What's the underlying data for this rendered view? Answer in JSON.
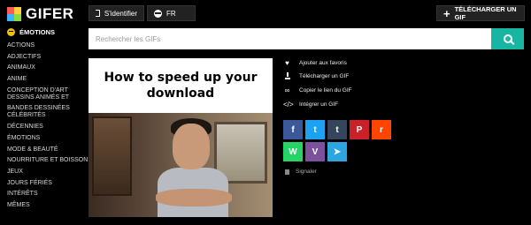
{
  "brand": {
    "name": "GIFER"
  },
  "header": {
    "signin_label": "S'identifier",
    "language_label": "FR",
    "upload_label": "TÉLÉCHARGER UN GIF"
  },
  "search": {
    "placeholder": "Rechercher les GIFs",
    "value": ""
  },
  "sidebar": {
    "title": "ÉMOTIONS",
    "items": [
      "ACTIONS",
      "ADJECTIFS",
      "ANIMAUX",
      "ANIME",
      "CONCEPTION D'ART DESSINS ANIMÉS ET",
      "BANDES DESSINÉES CÉLÉBRITÉS",
      "DÉCENNIES",
      "ÉMOTIONS",
      "MODE & BEAUTÉ",
      "NOURRITURE ET BOISSON",
      "JEUX",
      "JOURS FÉRIÉS",
      "INTÉRÊTS",
      "MÊMES"
    ]
  },
  "media": {
    "caption": "How to speed up your download"
  },
  "actions": {
    "favorite_label": "Ajouter aux favoris",
    "download_label": "Télécharger un GIF",
    "copy_link_label": "Copier le lien du GIF",
    "embed_label": "Intégrer un GIF"
  },
  "share": {
    "facebook": "f",
    "twitter": "t",
    "tumblr": "t",
    "pinterest": "P",
    "reddit": "r",
    "whatsapp": "W",
    "viber": "V",
    "telegram": "➤"
  },
  "report_label": "Signaler",
  "colors": {
    "accent": "#18b6a2",
    "background": "#000000"
  }
}
